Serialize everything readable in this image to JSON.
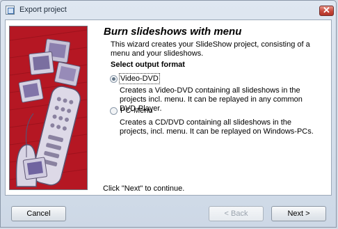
{
  "window": {
    "title": "Export project",
    "close_glyph": "✕"
  },
  "wizard": {
    "heading": "Burn slideshows with menu",
    "description": "This wizard creates your SlideShow project, consisting of a menu and your slideshows.",
    "section_label": "Select output format",
    "options": [
      {
        "label": "Video-DVD",
        "selected": true,
        "description": "Creates a Video-DVD containing all slideshows in the projects incl. menu. It can be replayed in any common DVD-Player."
      },
      {
        "label": "PC-Menu",
        "selected": false,
        "description": "Creates a CD/DVD containing all slideshows in the projects, incl. menu. It can be replayed on Windows-PCs."
      }
    ],
    "footer_hint": "Click \"Next\" to continue."
  },
  "buttons": {
    "cancel": "Cancel",
    "back": "< Back",
    "next": "Next >"
  },
  "icons": {
    "app": "window-icon",
    "close": "close-icon"
  },
  "colors": {
    "side_image_background": "#b51723",
    "title_bar": "#dfe7f1",
    "close_button": "#c6483b"
  }
}
